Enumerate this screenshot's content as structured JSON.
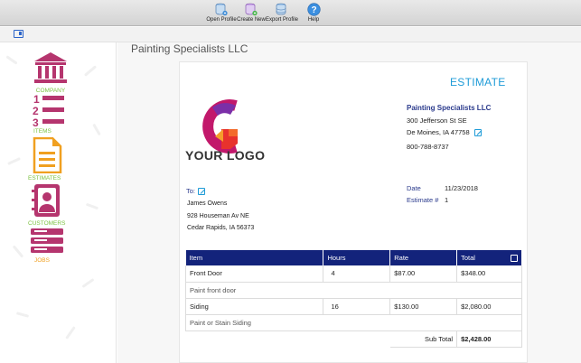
{
  "toolbar": {
    "buttons": [
      {
        "label": "Open Profile",
        "icon": "database-open-icon"
      },
      {
        "label": "Create New",
        "icon": "database-add-icon"
      },
      {
        "label": "Export Profile",
        "icon": "database-export-icon"
      },
      {
        "label": "Help",
        "icon": "help-icon"
      }
    ]
  },
  "sidebar": {
    "items": [
      {
        "label": "COMPANY",
        "icon": "bank-icon"
      },
      {
        "label": "ITEMS",
        "icon": "numbered-list-icon"
      },
      {
        "label": "ESTIMATES",
        "icon": "document-icon"
      },
      {
        "label": "CUSTOMERS",
        "icon": "contact-book-icon"
      },
      {
        "label": "JOBS",
        "icon": "stack-icon"
      }
    ]
  },
  "main": {
    "title": "Painting Specialists LLC"
  },
  "estimate": {
    "heading": "ESTIMATE",
    "logo_text": "YOUR LOGO",
    "company": {
      "name": "Painting Specialists LLC",
      "street": "300 Jefferson St SE",
      "city": "De Moines, IA 47758",
      "phone": "800-788-8737"
    },
    "to_label": "To:",
    "client": {
      "name": "James Owens",
      "street": "928 Houseman Av NE",
      "city": "Cedar Rapids, IA 56373"
    },
    "date_label": "Date",
    "date_value": "11/23/2018",
    "number_label": "Estimate #",
    "number_value": "1",
    "table": {
      "headers": [
        "Item",
        "Hours",
        "Rate",
        "Total"
      ],
      "rows": [
        {
          "item": "Front Door",
          "hours": "4",
          "rate": "$87.00",
          "total": "$348.00",
          "description": "Paint front door"
        },
        {
          "item": "Siding",
          "hours": "16",
          "rate": "$130.00",
          "total": "$2,080.00",
          "description": "Paint or Stain Siding"
        }
      ],
      "subtotal_label": "Sub Total",
      "subtotal_value": "$2,428.00"
    }
  },
  "colors": {
    "sidebar_icon": "#b5356e",
    "sidebar_label": "#7cc142",
    "estimates_icon": "#f0a020",
    "header_bg": "#13237b",
    "accent_blue": "#1e9bd7"
  }
}
